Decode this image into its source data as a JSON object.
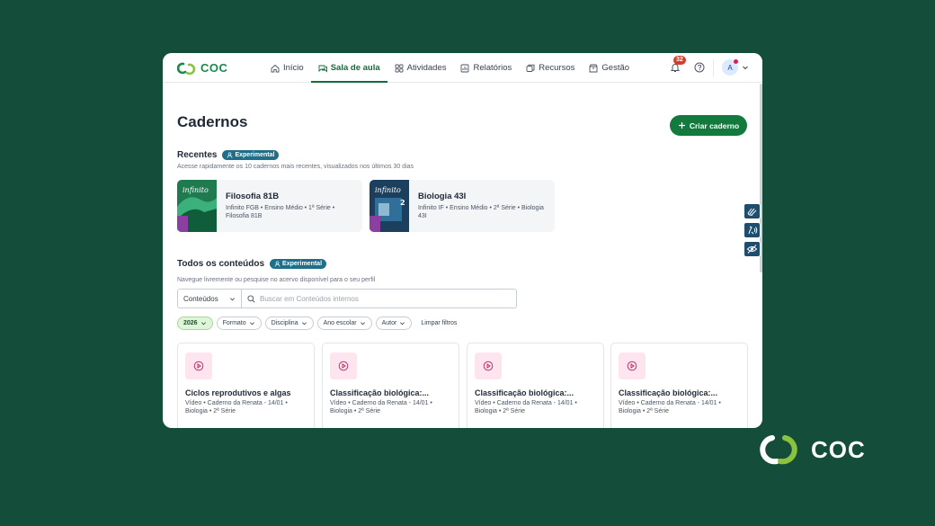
{
  "brand": {
    "logo_text": "COC",
    "footer_logo_text": "COC"
  },
  "nav": {
    "items": [
      {
        "label": "Início",
        "icon": "home-icon"
      },
      {
        "label": "Sala de aula",
        "icon": "chat-icon"
      },
      {
        "label": "Atividades",
        "icon": "grid-icon"
      },
      {
        "label": "Relatórios",
        "icon": "chart-icon"
      },
      {
        "label": "Recursos",
        "icon": "folders-icon"
      },
      {
        "label": "Gestão",
        "icon": "box-icon"
      }
    ],
    "active": "Sala de aula",
    "notification_count": "32",
    "avatar_initial": "A"
  },
  "page": {
    "title": "Cadernos",
    "create_button": "Criar caderno"
  },
  "recentes": {
    "title": "Recentes",
    "badge": "Experimental",
    "subtitle": "Acesse rapidamente os 10 cadernos mais recentes, visualizados nos últimos 30 dias",
    "cards": [
      {
        "title": "Filosofia 81B",
        "meta": "Infinito FGB • Ensino Médio • 1ª Série • Filosofia 81B"
      },
      {
        "title": "Biologia 43I",
        "meta": "Infinito IF • Ensino Médio • 2ª Série • Biologia 43I"
      }
    ]
  },
  "conteudos": {
    "title": "Todos os conteúdos",
    "badge": "Experimental",
    "subtitle": "Navegue livremente ou pesquise no acervo disponível para o seu perfil",
    "select_value": "Conteúdos",
    "search_placeholder": "Buscar em Conteúdos internos",
    "filters": [
      "2026",
      "Formato",
      "Disciplina",
      "Ano escolar",
      "Autor"
    ],
    "clear_filters": "Limpar filtros",
    "cards": [
      {
        "title": "Ciclos reprodutivos e algas",
        "meta": "Vídeo • Caderno da Renata - 14/01 • Biologia • 2ª Série"
      },
      {
        "title": "Classificação biológica:...",
        "meta": "Vídeo • Caderno da Renata - 14/01 • Biologia • 2ª Série"
      },
      {
        "title": "Classificação biológica:...",
        "meta": "Vídeo • Caderno da Renata - 14/01 • Biologia • 2ª Série"
      },
      {
        "title": "Classificação biológica:...",
        "meta": "Vídeo • Caderno da Renata - 14/01 • Biologia • 2ª Série"
      }
    ]
  },
  "colors": {
    "background": "#144e3b",
    "primary": "#137a3e",
    "badge": "#1f6f8b",
    "notification": "#d93c2b"
  }
}
